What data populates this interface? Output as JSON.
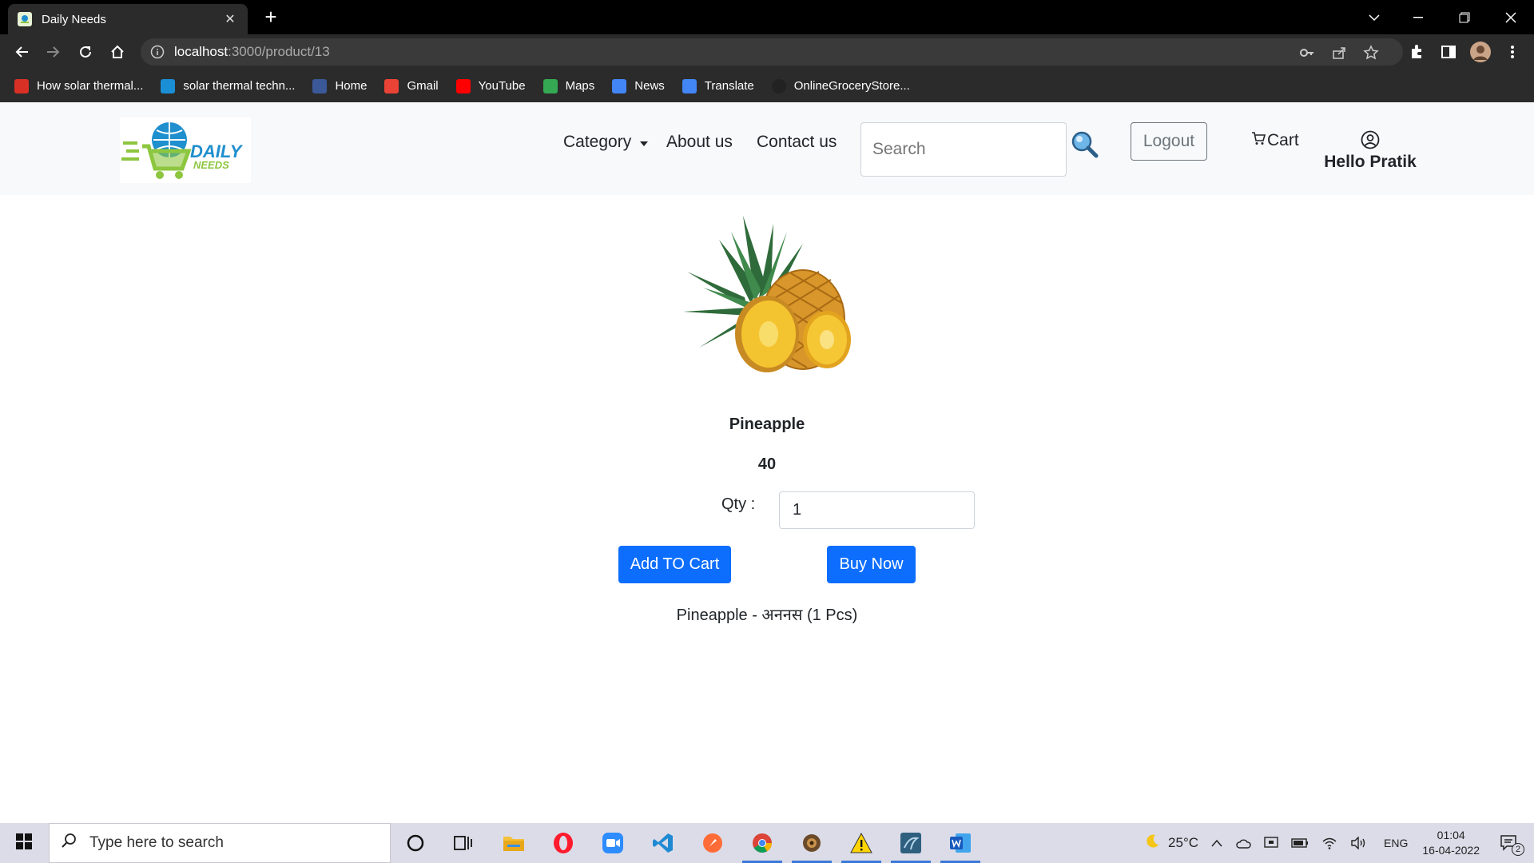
{
  "browser": {
    "tab_title": "Daily Needs",
    "url_host": "localhost",
    "url_path": ":3000/product/13",
    "bookmarks": [
      {
        "label": "How solar thermal...",
        "color": "#d93025"
      },
      {
        "label": "solar thermal techn...",
        "color": "#1a8fd6"
      },
      {
        "label": "Home",
        "color": "#3b5998"
      },
      {
        "label": "Gmail",
        "color": "#ea4335"
      },
      {
        "label": "YouTube",
        "color": "#ff0000"
      },
      {
        "label": "Maps",
        "color": "#34a853"
      },
      {
        "label": "News",
        "color": "#4285f4"
      },
      {
        "label": "Translate",
        "color": "#4285f4"
      },
      {
        "label": "OnlineGroceryStore...",
        "color": "#222222"
      }
    ]
  },
  "site": {
    "logo_text_1": "DAILY",
    "logo_text_2": "NEEDS",
    "nav": {
      "category": "Category",
      "about": "About us",
      "contact": "Contact us"
    },
    "search_placeholder": "Search",
    "logout": "Logout",
    "cart": "Cart",
    "greeting": "Hello Pratik"
  },
  "product": {
    "name": "Pineapple",
    "price": "40",
    "qty_label": "Qty :",
    "qty_value": "1",
    "add_to_cart": "Add TO Cart",
    "buy_now": "Buy Now",
    "description": "Pineapple - अननस (1 Pcs)"
  },
  "taskbar": {
    "search_placeholder": "Type here to search",
    "weather": "25°C",
    "language": "ENG",
    "time": "01:04",
    "date": "16-04-2022",
    "notifications": "2"
  },
  "colors": {
    "primary": "#0d6efd",
    "navbar_bg": "#f8f9fa",
    "logo_green": "#8dc63f",
    "logo_blue": "#1f8fce"
  }
}
